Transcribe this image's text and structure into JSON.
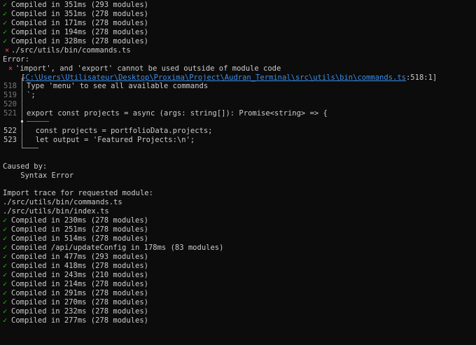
{
  "glyphs": {
    "check": "✓",
    "cross": "×"
  },
  "log_top": [
    "Compiled in 351ms (293 modules)",
    "Compiled in 351ms (278 modules)",
    "Compiled in 171ms (278 modules)",
    "Compiled in 194ms (278 modules)",
    "Compiled in 328ms (278 modules)"
  ],
  "error_block": {
    "failed_file": "./src/utils/bin/commands.ts",
    "error_label": "Error:",
    "message": "'import', and 'export' cannot be used outside of module code",
    "location_prefix": "[",
    "location_path": "C:\\Users\\Utilisateur\\Desktop\\Proxima\\Project\\Audran_Terminal\\src\\utils\\bin\\commands.ts",
    "location_suffix": ":518:1]",
    "code_lines": [
      {
        "num": "518",
        "text": "Type 'menu' to see all available commands"
      },
      {
        "num": "519",
        "text": "`;"
      },
      {
        "num": "520",
        "text": ""
      },
      {
        "num": "521",
        "text": "export const projects = async (args: string[]): Promise<string> => {"
      },
      {
        "num": "522",
        "text": "  const projects = portfolioData.projects;"
      },
      {
        "num": "523",
        "text": "  let output = 'Featured Projects:\\n';"
      }
    ]
  },
  "caused_by": {
    "label": "Caused by:",
    "detail": "    Syntax Error"
  },
  "import_trace": {
    "label": "Import trace for requested module:",
    "files": [
      "./src/utils/bin/commands.ts",
      "./src/utils/bin/index.ts"
    ]
  },
  "log_bottom": [
    "Compiled in 230ms (278 modules)",
    "Compiled in 251ms (278 modules)",
    "Compiled in 514ms (278 modules)",
    "Compiled /api/updateConfig in 178ms (83 modules)",
    "Compiled in 477ms (293 modules)",
    "Compiled in 418ms (278 modules)",
    "Compiled in 243ms (210 modules)",
    "Compiled in 214ms (278 modules)",
    "Compiled in 291ms (278 modules)",
    "Compiled in 270ms (278 modules)",
    "Compiled in 232ms (278 modules)",
    "Compiled in 277ms (278 modules)"
  ],
  "colors": {
    "background": "#0c0c0c",
    "text": "#cccccc",
    "success": "#16c60c",
    "error": "#e74856",
    "link": "#3b8eea",
    "highlight": "#c239b3"
  }
}
